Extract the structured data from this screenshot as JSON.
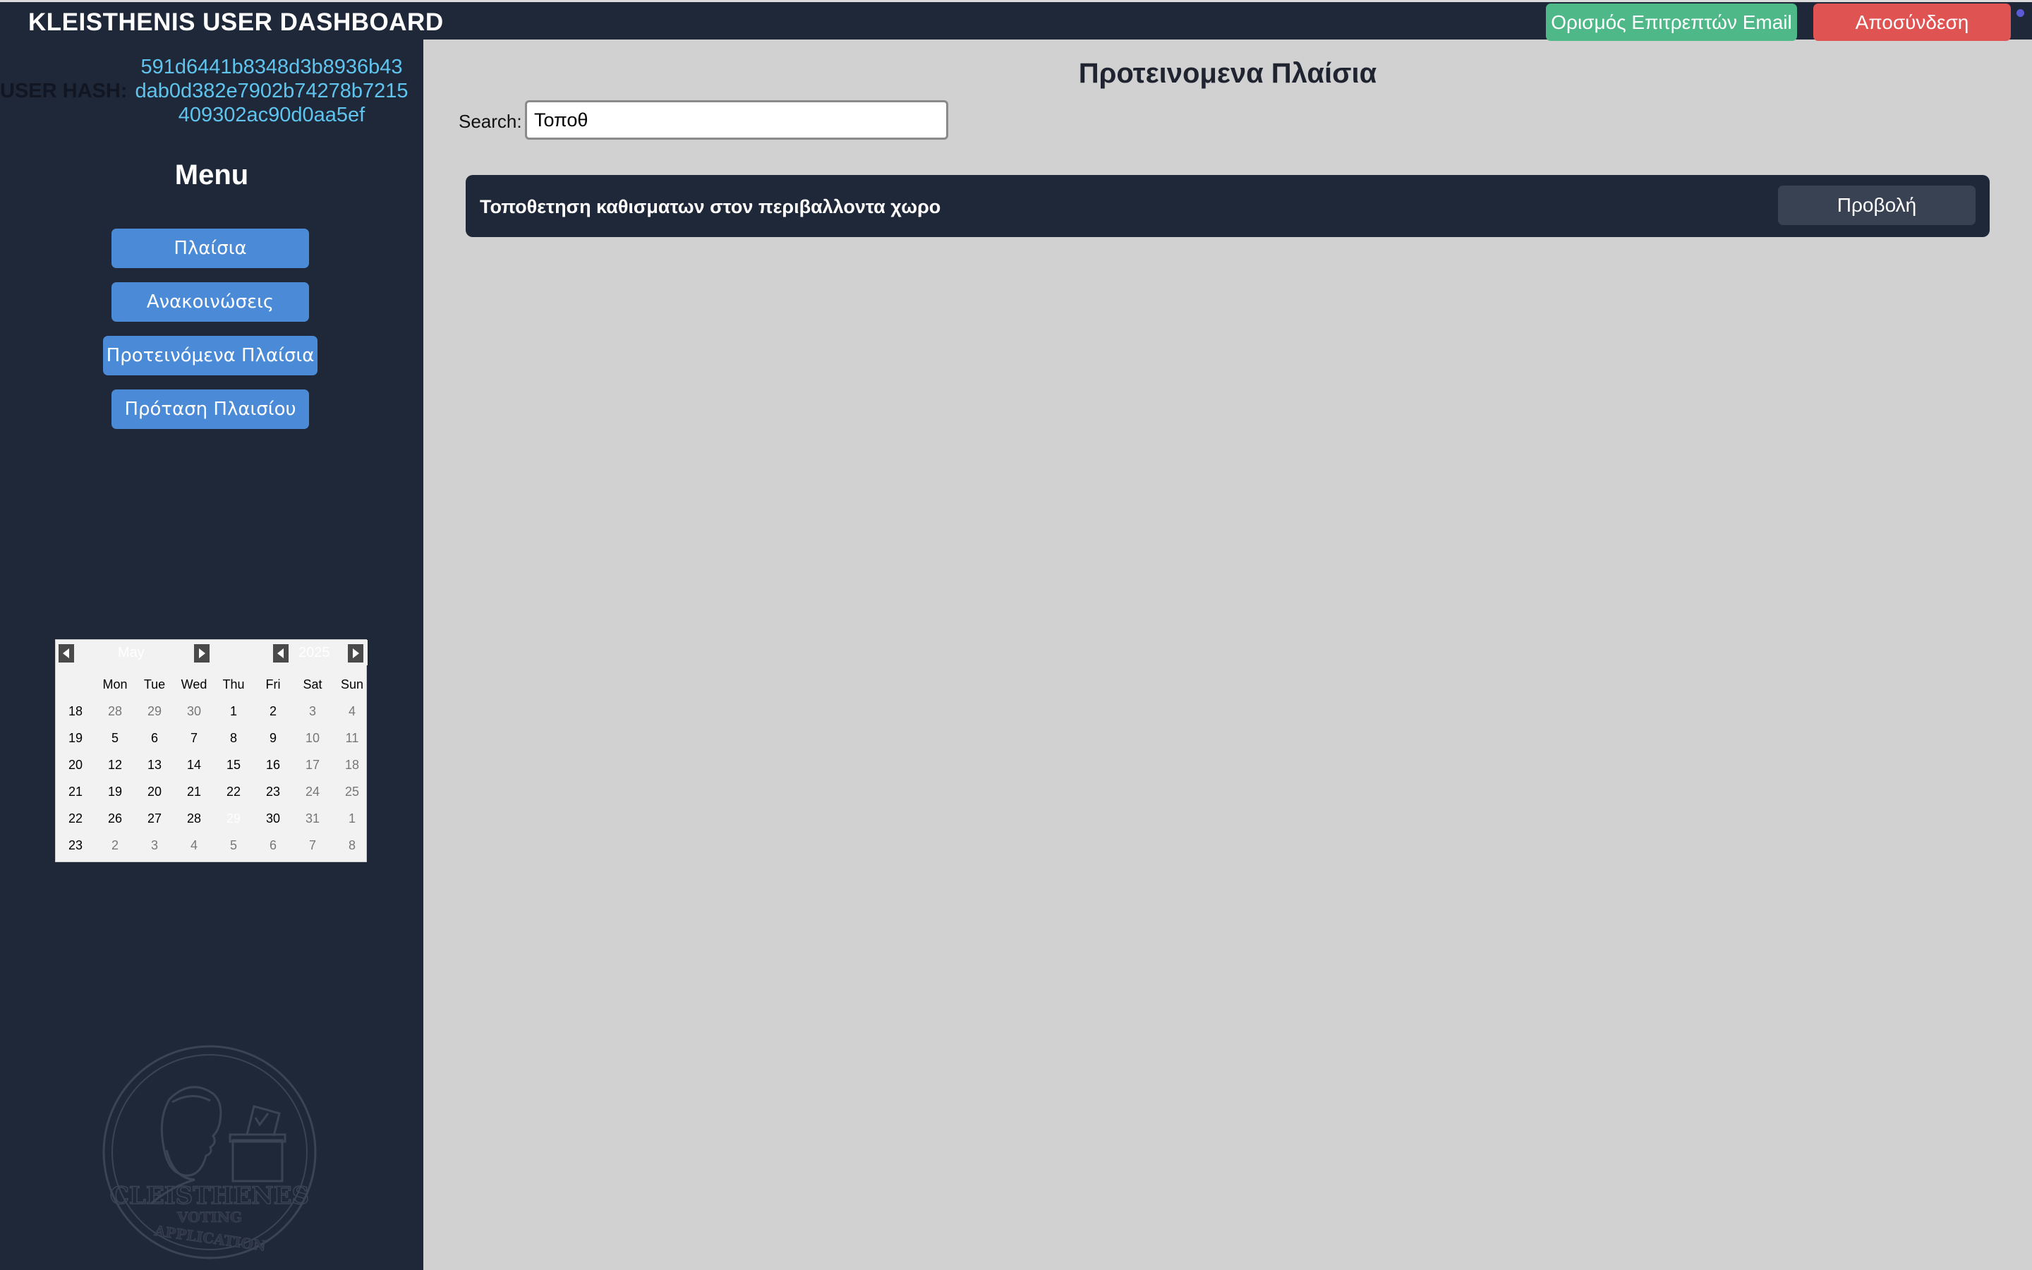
{
  "header": {
    "title": "KLEISTHENIS USER DASHBOARD",
    "email_button": "Ορισμός Επιτρεπτών Email",
    "logout_button": "Αποσύνδεση"
  },
  "user": {
    "hash_label": "USER HASH:",
    "hash_line1": "591d6441b8348d3b8936b43",
    "hash_line2": "dab0d382e7902b74278b7215",
    "hash_line3": "409302ac90d0aa5ef"
  },
  "sidebar": {
    "menu_title": "Menu",
    "items": [
      {
        "label": "Πλαίσια"
      },
      {
        "label": "Ανακοινώσεις"
      },
      {
        "label": "Προτεινόμενα Πλαίσια"
      },
      {
        "label": "Πρόταση Πλαισίου"
      }
    ]
  },
  "calendar": {
    "month": "May",
    "year": "2025",
    "weekdays": [
      "Mon",
      "Tue",
      "Wed",
      "Thu",
      "Fri",
      "Sat",
      "Sun"
    ],
    "weeks": [
      {
        "week": "18",
        "days": [
          "28",
          "29",
          "30",
          "1",
          "2",
          "3",
          "4"
        ]
      },
      {
        "week": "19",
        "days": [
          "5",
          "6",
          "7",
          "8",
          "9",
          "10",
          "11"
        ]
      },
      {
        "week": "20",
        "days": [
          "12",
          "13",
          "14",
          "15",
          "16",
          "17",
          "18"
        ]
      },
      {
        "week": "21",
        "days": [
          "19",
          "20",
          "21",
          "22",
          "23",
          "24",
          "25"
        ]
      },
      {
        "week": "22",
        "days": [
          "26",
          "27",
          "28",
          "29",
          "30",
          "31",
          "1"
        ]
      },
      {
        "week": "23",
        "days": [
          "2",
          "3",
          "4",
          "5",
          "6",
          "7",
          "8"
        ]
      }
    ],
    "selected_day": "29"
  },
  "seal": {
    "line1": "CLEISTHENES",
    "line2": "VOTING",
    "line3": "APPLICATION"
  },
  "main": {
    "page_title": "Προτεινομενα Πλαίσια",
    "search_label": "Search:",
    "search_value": "Τοποθ",
    "proposals": [
      {
        "title": "Τοποθετηση καθισματων στον περιβαλλοντα χωρο",
        "view_label": "Προβολή"
      }
    ]
  },
  "colors": {
    "sidebar_bg": "#1f2838",
    "main_bg": "#d1d1d1",
    "email_button": "#4fb888",
    "logout_button": "#e05353",
    "menu_button": "#4a8ad6",
    "hash_text": "#5fc4ee"
  }
}
